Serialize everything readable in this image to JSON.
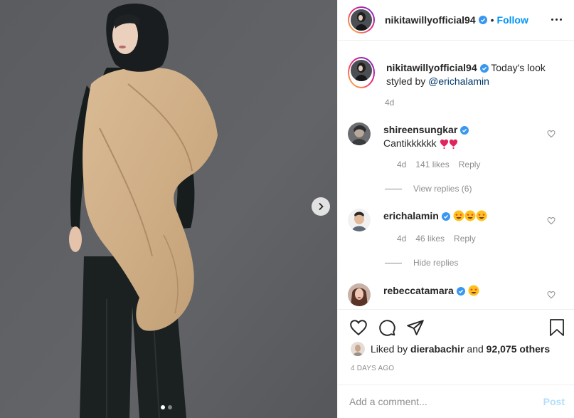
{
  "post": {
    "author": "nikitawillyofficial94",
    "follow_label": "Follow",
    "separator": "•",
    "caption_text": "Today's look styled by ",
    "caption_mention": "@erichalamin",
    "caption_age": "4d"
  },
  "comments": [
    {
      "username": "shireensungkar",
      "text": "Cantikkkkkk",
      "emoji": [
        "red-heart-exclamation",
        "red-heart-exclamation"
      ],
      "age": "4d",
      "likes": "141 likes",
      "reply": "Reply",
      "replies_toggle": "View replies (6)"
    },
    {
      "username": "erichalamin",
      "text": "",
      "emoji": [
        "star-struck",
        "star-struck",
        "star-struck"
      ],
      "age": "4d",
      "likes": "46 likes",
      "reply": "Reply",
      "replies_toggle": "Hide replies"
    },
    {
      "username": "rebeccatamara",
      "text": "",
      "emoji": [
        "star-struck"
      ]
    }
  ],
  "footer": {
    "liked_prefix": "Liked by ",
    "liked_user": "dierabachir",
    "liked_and": " and ",
    "liked_count": "92,075 others",
    "date": "4 DAYS AGO",
    "comment_placeholder": "Add a comment...",
    "post_label": "Post"
  },
  "carousel": {
    "slides": 2,
    "active": 0
  },
  "colors": {
    "accent": "#0095f6",
    "verified": "#3897f0",
    "muted": "#8e8e8e",
    "post_disabled": "#b2dffc"
  }
}
